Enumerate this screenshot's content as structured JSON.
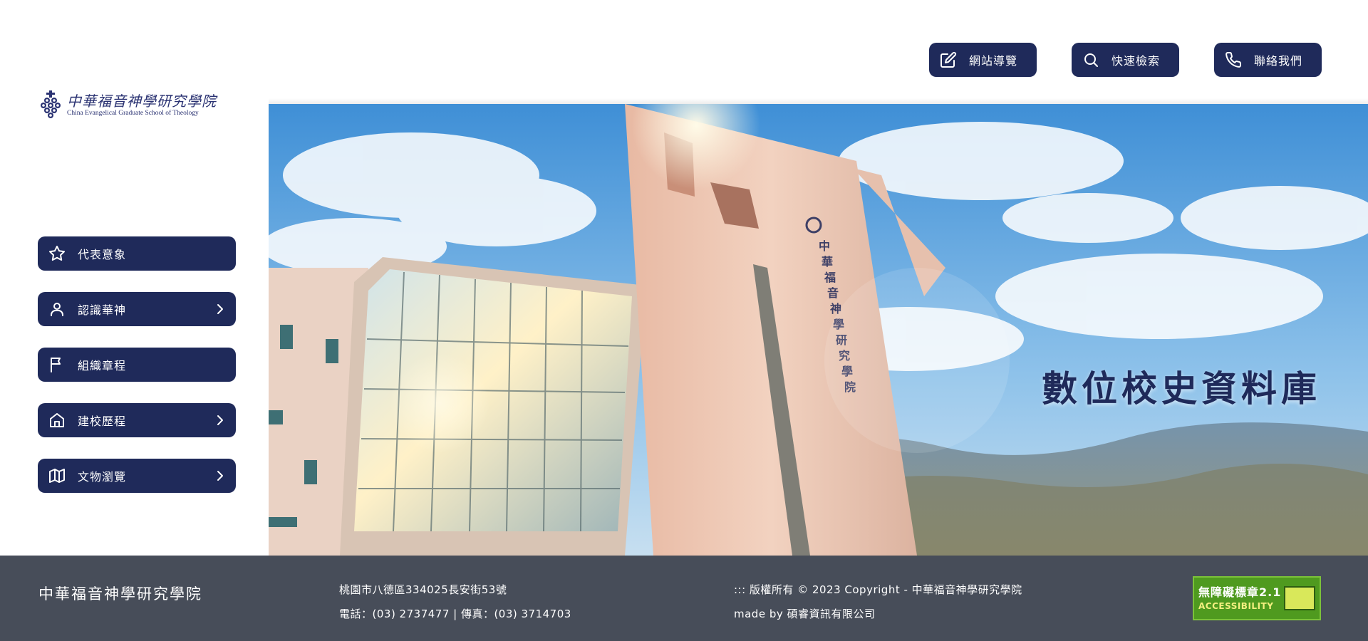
{
  "logo": {
    "zh": "中華福音神學研究學院",
    "en": "China Evangelical  Graduate School of Theology"
  },
  "top_nav": [
    {
      "label": "網站導覽",
      "icon": "edit-icon"
    },
    {
      "label": "快速檢索",
      "icon": "search-icon"
    },
    {
      "label": "聯絡我們",
      "icon": "phone-icon"
    }
  ],
  "sidebar": {
    "items": [
      {
        "label": "代表意象",
        "icon": "star-icon",
        "has_submenu": false
      },
      {
        "label": "認識華神",
        "icon": "user-icon",
        "has_submenu": true
      },
      {
        "label": "組織章程",
        "icon": "flag-icon",
        "has_submenu": false
      },
      {
        "label": "建校歷程",
        "icon": "home-icon",
        "has_submenu": true
      },
      {
        "label": "文物瀏覽",
        "icon": "map-icon",
        "has_submenu": true
      }
    ]
  },
  "hero": {
    "title": "數位校史資料庫",
    "building_sign": "中華福音神學研究學院"
  },
  "footer": {
    "name": "中華福音神學研究學院",
    "address": "桃園市八德區334025長安街53號",
    "phone": "電話：(03) 2737477 | 傳真：(03) 3714703",
    "copyright": "::: 版權所有 © 2023 Copyright - 中華福音神學研究學院",
    "made_by": "made by 碩睿資訊有限公司",
    "badge_line1": "無障礙標章2.1",
    "badge_line2": "ACCESSIBILITY"
  },
  "colors": {
    "navy": "#1f2a5a",
    "footer_bg": "#474d59",
    "badge_green": "#4f9a1f"
  }
}
